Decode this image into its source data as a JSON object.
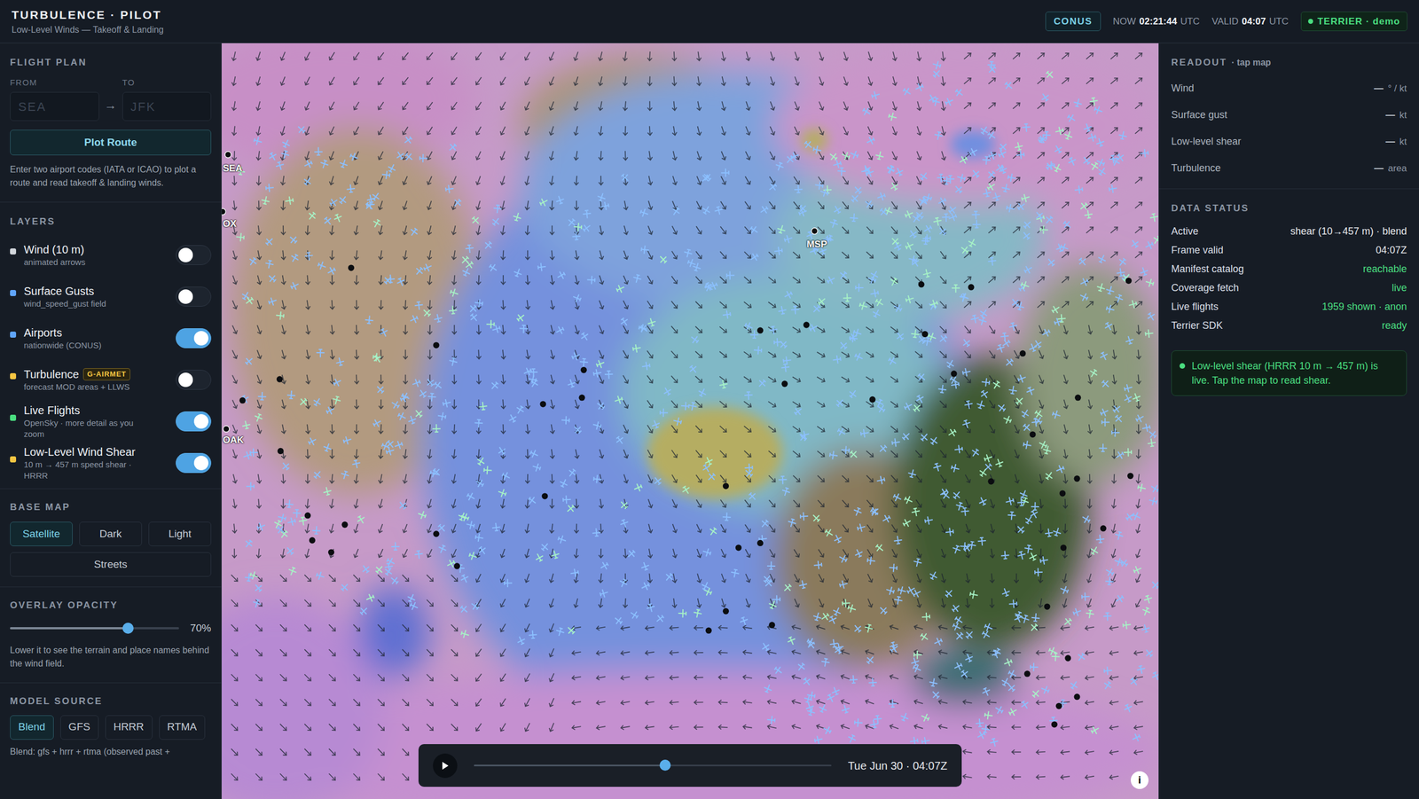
{
  "header": {
    "title": "TURBULENCE · PILOT",
    "subtitle": "Low-Level Winds — Takeoff & Landing",
    "region": "CONUS",
    "now_label": "NOW",
    "now": "02:21:44",
    "now_unit": "UTC",
    "valid_label": "VALID",
    "valid": "04:07",
    "valid_unit": "UTC",
    "status": {
      "label": "TERRIER · demo",
      "color": "#4ade80"
    }
  },
  "flight_plan": {
    "heading": "FLIGHT PLAN",
    "from_label": "FROM",
    "to_label": "TO",
    "from_placeholder": "SEA",
    "to_placeholder": "JFK",
    "arrow": "→",
    "button": "Plot Route",
    "help": "Enter two airport codes (IATA or ICAO) to plot a route and read takeoff & landing winds."
  },
  "layers": {
    "heading": "LAYERS",
    "items": [
      {
        "name": "Wind (10 m)",
        "sub": "animated arrows",
        "color": "#d1d5db",
        "on": false
      },
      {
        "name": "Surface Gusts",
        "sub": "wind_speed_gust field",
        "color": "#60a5fa",
        "on": false
      },
      {
        "name": "Airports",
        "sub": "nationwide (CONUS)",
        "color": "#60a5fa",
        "on": true
      },
      {
        "name": "Turbulence",
        "badge": "G-AIRMET",
        "sub": "forecast MOD areas + LLWS",
        "color": "#f5c542",
        "on": false
      },
      {
        "name": "Live Flights",
        "sub": "OpenSky · more detail as you zoom",
        "color": "#4ade80",
        "on": true
      },
      {
        "name": "Low-Level Wind Shear",
        "sub": "10 m → 457 m speed shear · HRRR",
        "color": "#f5c542",
        "on": true
      }
    ]
  },
  "base_map": {
    "heading": "BASE MAP",
    "options": [
      {
        "label": "Satellite",
        "selected": true
      },
      {
        "label": "Dark",
        "selected": false
      },
      {
        "label": "Light",
        "selected": false
      },
      {
        "label": "Streets",
        "selected": false
      }
    ]
  },
  "opacity": {
    "heading": "OVERLAY OPACITY",
    "level": 0.7,
    "reading": "70%",
    "help": "Lower it to see the terrain and place names behind the wind field."
  },
  "model_source": {
    "heading": "MODEL SOURCE",
    "options": [
      {
        "label": "Blend",
        "selected": true
      },
      {
        "label": "GFS",
        "selected": false
      },
      {
        "label": "HRRR",
        "selected": false
      },
      {
        "label": "RTMA",
        "selected": false
      }
    ],
    "note": "Blend: gfs + hrrr + rtma (observed past +"
  },
  "map": {
    "airports": [
      {
        "code": "SEA"
      },
      {
        "code": "OX"
      },
      {
        "code": "OAK"
      },
      {
        "code": "MSP"
      }
    ],
    "timeline": {
      "playing": false,
      "level": 0.535,
      "label": "Tue Jun 30 · 04:07Z"
    },
    "info": "i"
  },
  "readout": {
    "heading": "READOUT",
    "sub": "· tap map",
    "rows": [
      {
        "label": "Wind",
        "value": "—",
        "unit": "° / kt"
      },
      {
        "label": "Surface gust",
        "value": "—",
        "unit": "kt"
      },
      {
        "label": "Low-level shear",
        "value": "—",
        "unit": "kt"
      },
      {
        "label": "Turbulence",
        "value": "—",
        "unit": "area"
      }
    ]
  },
  "data_status": {
    "heading": "DATA STATUS",
    "rows": [
      {
        "label": "Active",
        "value": "shear (10→457 m) · blend",
        "color": "#e5e7eb"
      },
      {
        "label": "Frame valid",
        "value": "04:07Z",
        "color": "#e5e7eb"
      },
      {
        "label": "Manifest catalog",
        "value": "reachable",
        "color": "#4ade80"
      },
      {
        "label": "Coverage fetch",
        "value": "live",
        "color": "#4ade80"
      },
      {
        "label": "Live flights",
        "value": "1959 shown · anon",
        "color": "#4ade80"
      },
      {
        "label": "Terrier SDK",
        "value": "ready",
        "color": "#4ade80"
      }
    ]
  },
  "alert": {
    "text": "Low-level shear (HRRR 10 m → 457 m) is live. Tap the map to read shear.",
    "color": "#4ade80"
  }
}
